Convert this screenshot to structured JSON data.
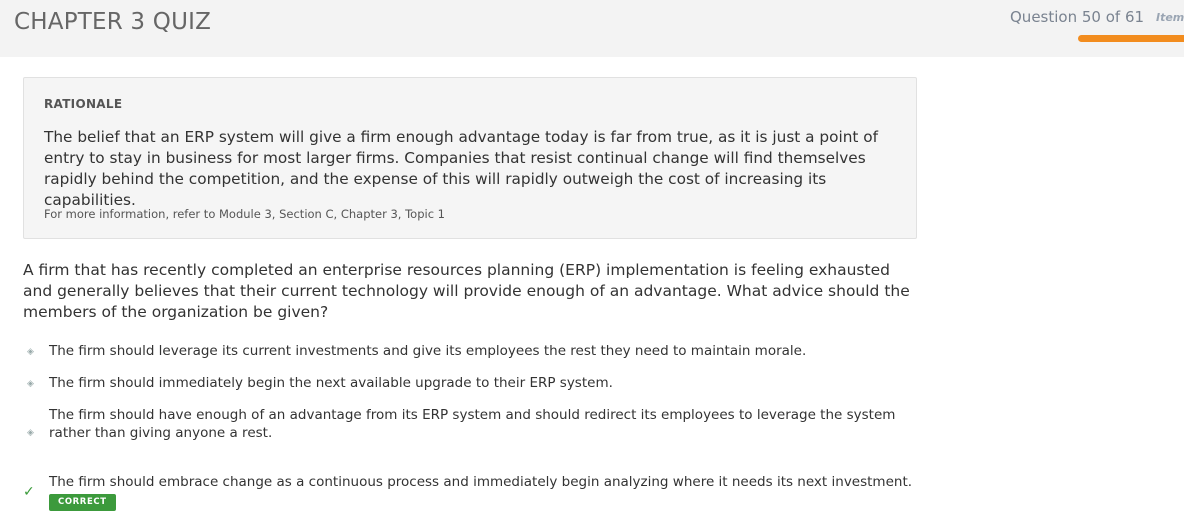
{
  "header": {
    "title": "CHAPTER 3 QUIZ",
    "question_counter": "Question 50 of 61",
    "item_label": "Item",
    "progress": 0.82
  },
  "rationale": {
    "heading": "RATIONALE",
    "body": "The belief that an ERP system will give a firm enough advantage today is far from true, as it is just a point of entry to stay in business for most larger firms. Companies that resist continual change will find themselves rapidly behind the competition, and the expense of this will rapidly outweigh the cost of increasing its capabilities.",
    "reference": "For more information, refer to Module 3, Section C, Chapter 3, Topic 1"
  },
  "question": {
    "text": "A firm that has recently completed an enterprise resources planning (ERP) implementation is feeling exhausted and generally believes that their current technology will provide enough of an advantage. What advice should the members of the organization be given?"
  },
  "options": [
    {
      "text": "The firm should leverage its current investments and give its employees the rest they need to maintain morale."
    },
    {
      "text": "The firm should immediately begin the next available upgrade to their ERP system."
    },
    {
      "text": "The firm should have enough of an advantage from its ERP system and should redirect its employees to leverage the system rather than giving anyone a rest."
    },
    {
      "text": "The firm should embrace change as a continuous process and immediately begin analyzing where it needs its next investment.",
      "badge": "CORRECT"
    }
  ],
  "icons": {
    "bullet": "diamond-bullet-icon",
    "correct": "checkmark-icon"
  },
  "colors": {
    "progress": "#f28c1e",
    "correct": "#3c9a3c"
  }
}
